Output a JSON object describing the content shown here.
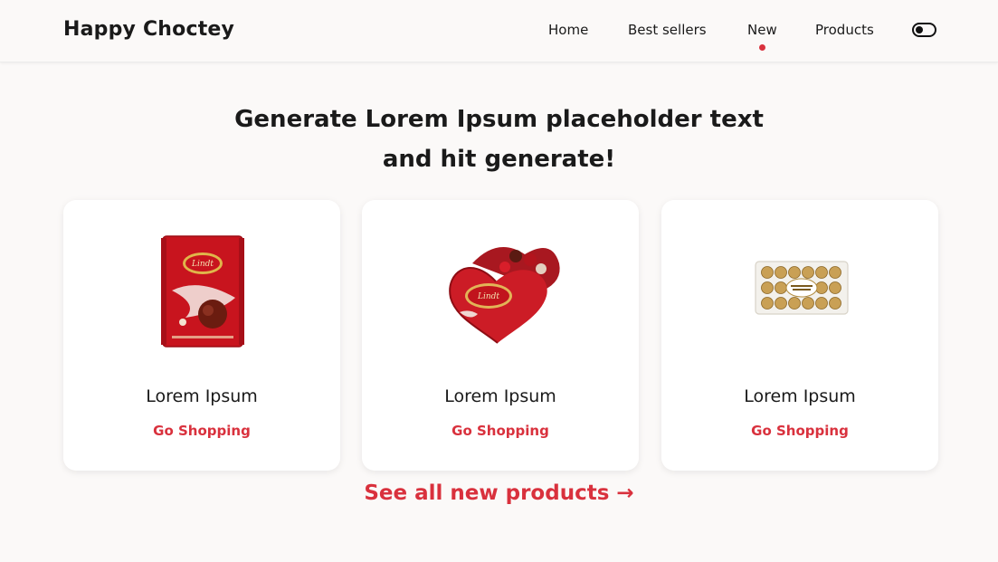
{
  "header": {
    "brand": "Happy Choctey",
    "nav": [
      {
        "label": "Home"
      },
      {
        "label": "Best sellers"
      },
      {
        "label": "New",
        "active": true
      },
      {
        "label": "Products"
      }
    ],
    "theme_toggle_icon": "toggle-switch-icon"
  },
  "hero": {
    "line1": "Generate Lorem Ipsum placeholder text",
    "line2": "and hit generate!"
  },
  "products": [
    {
      "title": "Lorem Ipsum",
      "link": "Go Shopping",
      "image": "lindt-lindor-box-image"
    },
    {
      "title": "Lorem Ipsum",
      "link": "Go Shopping",
      "image": "lindt-heart-tin-image"
    },
    {
      "title": "Lorem Ipsum",
      "link": "Go Shopping",
      "image": "ferrero-rocher-box-image"
    }
  ],
  "see_all": "See all new products →",
  "colors": {
    "accent": "#d9313d",
    "background": "#fbf9f8",
    "card": "#ffffff",
    "text": "#1a1a1a"
  }
}
